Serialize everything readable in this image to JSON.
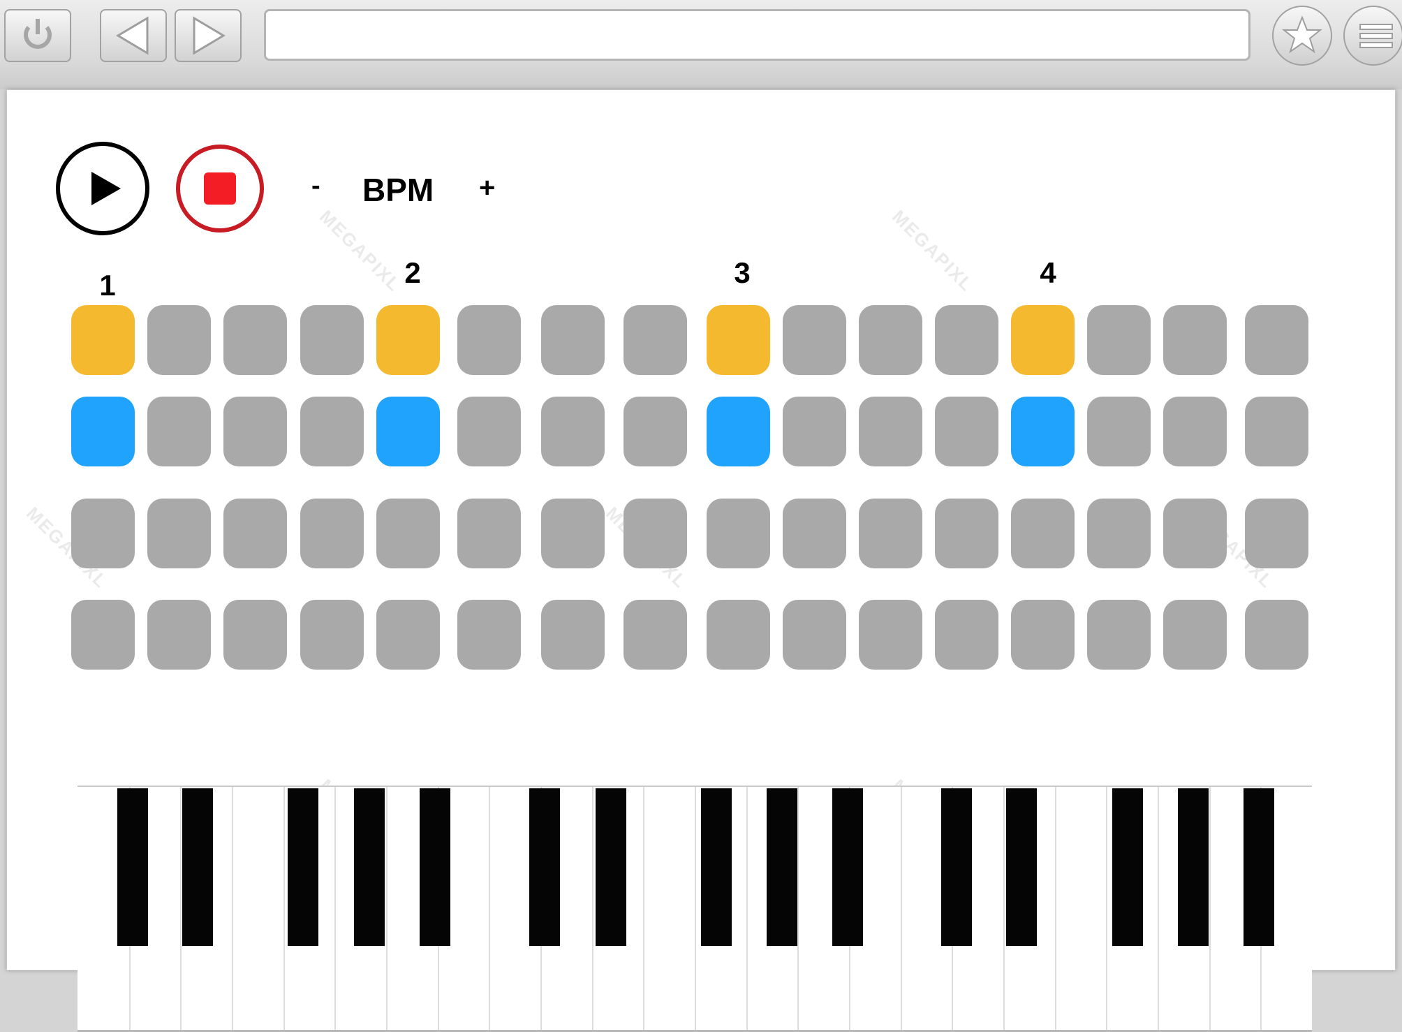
{
  "browser": {
    "address_value": "",
    "buttons": [
      "reload",
      "back",
      "forward",
      "bookmark",
      "menu"
    ]
  },
  "transport": {
    "play_icon": "play-icon",
    "stop_icon": "stop-icon",
    "decrease_label": "-",
    "tempo_label": "BPM",
    "increase_label": "+"
  },
  "sequencer": {
    "beats": [
      "1",
      "2",
      "3",
      "4"
    ],
    "rows": [
      {
        "active": [
          0,
          4,
          8,
          12
        ],
        "color": "#f4b92e"
      },
      {
        "active": [
          0,
          4,
          8,
          12
        ],
        "color": "#1fa3fc"
      },
      {
        "active": [],
        "color": "#a9a9a9"
      },
      {
        "active": [],
        "color": "#a9a9a9"
      }
    ],
    "steps": 16
  },
  "watermark": "MEGAPIXL",
  "colors": {
    "pad_off": "#a9a9a9",
    "pad_yellow": "#f4b92e",
    "pad_blue": "#1fa3fc",
    "stop_ring": "#c71c24",
    "stop_square": "#f21d25"
  }
}
